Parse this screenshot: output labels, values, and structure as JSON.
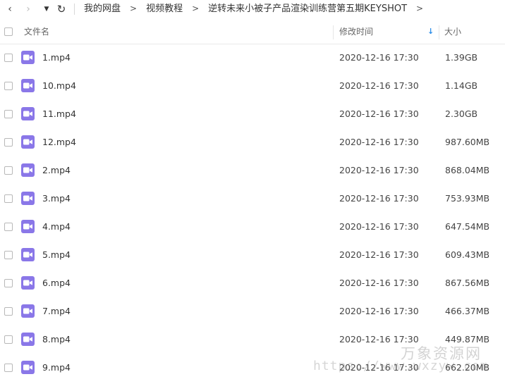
{
  "breadcrumb": {
    "items": [
      "我的网盘",
      "视频教程",
      "逆转未来小被子产品渲染训练营第五期KEYSHOT"
    ],
    "separator": ">"
  },
  "nav": {
    "back_icon": "chevron-left-icon",
    "forward_icon": "chevron-right-icon",
    "dropdown_icon": "caret-down-icon",
    "refresh_icon": "refresh-icon",
    "back_glyph": "‹",
    "forward_glyph": "›",
    "dropdown_glyph": "▼",
    "refresh_glyph": "↻"
  },
  "columns": {
    "name": "文件名",
    "modified": "修改时间",
    "size": "大小",
    "sort_arrow": "↓"
  },
  "colors": {
    "video_icon": "#8a77e8",
    "sort_arrow": "#2b8de8"
  },
  "files": [
    {
      "name": "1.mp4",
      "modified": "2020-12-16 17:30",
      "size": "1.39GB"
    },
    {
      "name": "10.mp4",
      "modified": "2020-12-16 17:30",
      "size": "1.14GB"
    },
    {
      "name": "11.mp4",
      "modified": "2020-12-16 17:30",
      "size": "2.30GB"
    },
    {
      "name": "12.mp4",
      "modified": "2020-12-16 17:30",
      "size": "987.60MB"
    },
    {
      "name": "2.mp4",
      "modified": "2020-12-16 17:30",
      "size": "868.04MB"
    },
    {
      "name": "3.mp4",
      "modified": "2020-12-16 17:30",
      "size": "753.93MB"
    },
    {
      "name": "4.mp4",
      "modified": "2020-12-16 17:30",
      "size": "647.54MB"
    },
    {
      "name": "5.mp4",
      "modified": "2020-12-16 17:30",
      "size": "609.43MB"
    },
    {
      "name": "6.mp4",
      "modified": "2020-12-16 17:30",
      "size": "867.56MB"
    },
    {
      "name": "7.mp4",
      "modified": "2020-12-16 17:30",
      "size": "466.37MB"
    },
    {
      "name": "8.mp4",
      "modified": "2020-12-16 17:30",
      "size": "449.87MB"
    },
    {
      "name": "9.mp4",
      "modified": "2020-12-16 17:30",
      "size": "662.20MB"
    }
  ],
  "watermark": {
    "line1": "万象资源网",
    "line2": "https://www.wxzyw.com"
  }
}
